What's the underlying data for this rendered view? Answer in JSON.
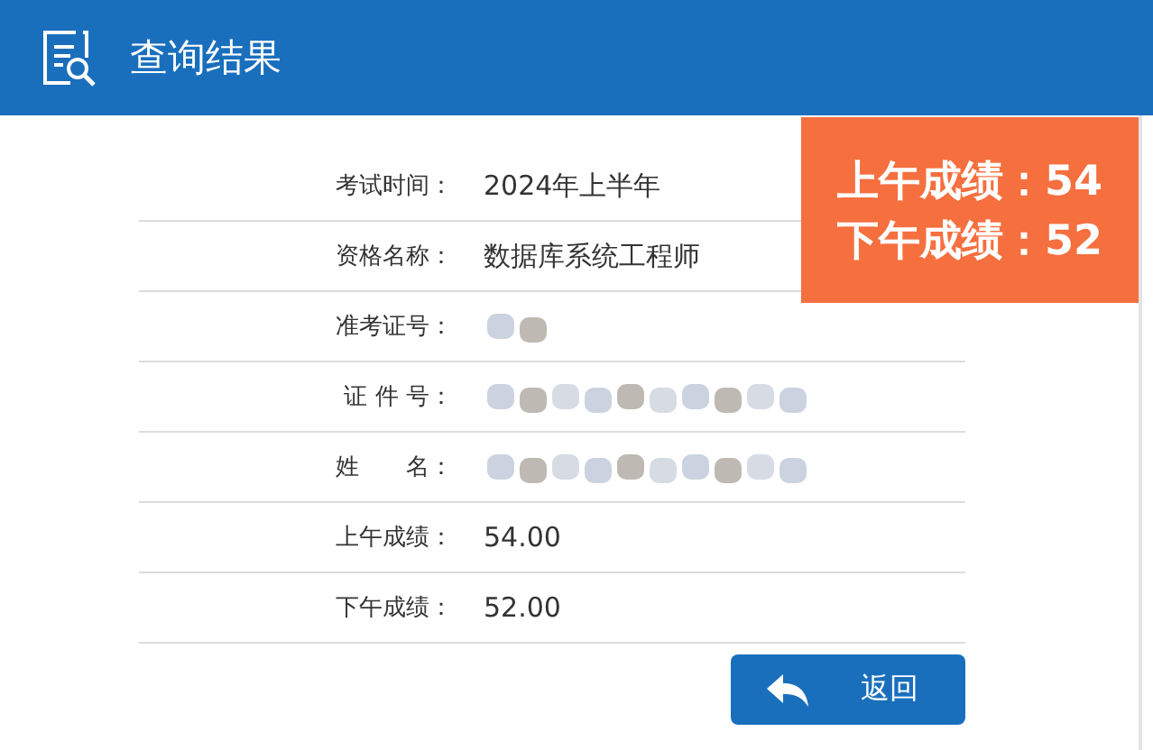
{
  "header": {
    "title": "查询结果"
  },
  "rows": [
    {
      "label": "考试时间：",
      "kind": "text",
      "value": "2024年上半年"
    },
    {
      "label": "资格名称：",
      "kind": "text",
      "value": "数据库系统工程师"
    },
    {
      "label": "准考证号：",
      "kind": "redacted"
    },
    {
      "label": "证 件 号：",
      "kind": "redacted"
    },
    {
      "label": "姓　　名：",
      "kind": "redacted"
    },
    {
      "label": "上午成绩：",
      "kind": "text",
      "value": "54.00"
    },
    {
      "label": "下午成绩：",
      "kind": "text",
      "value": "52.00"
    }
  ],
  "back_button": {
    "label": "返回"
  },
  "score_banner": {
    "lines": [
      "上午成绩：54",
      "下午成绩：52"
    ]
  }
}
